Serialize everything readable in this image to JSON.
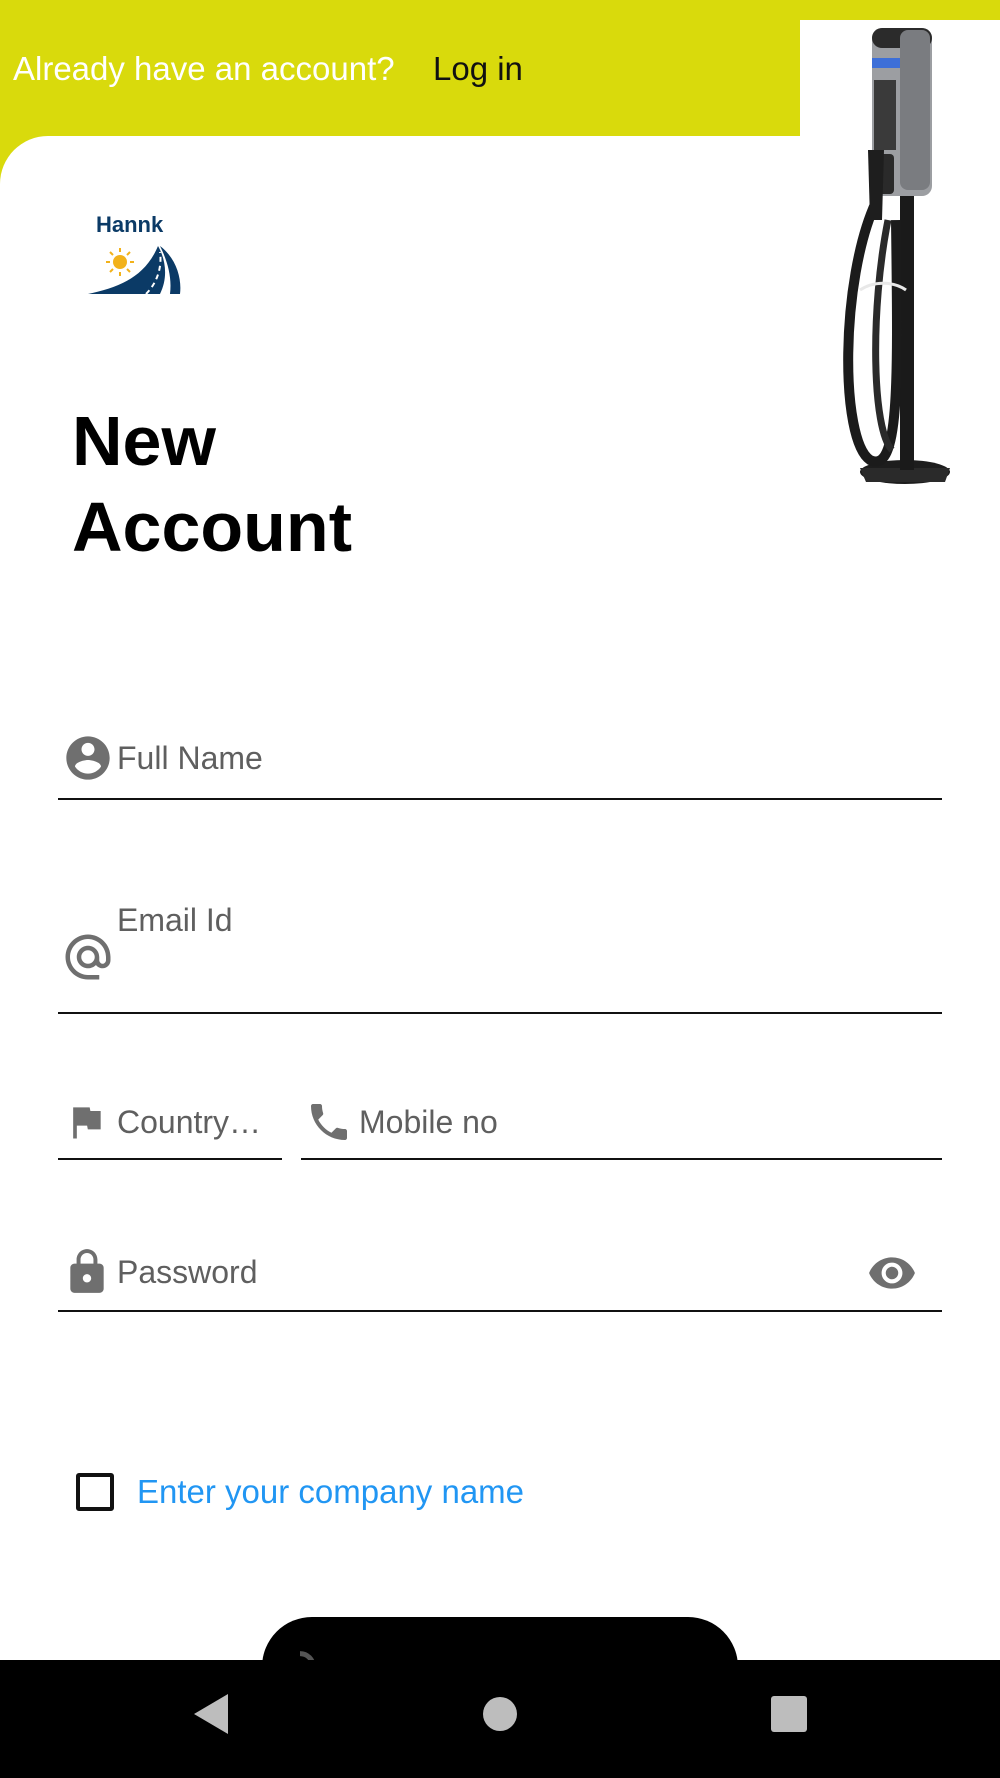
{
  "topbar": {
    "question": "Already have an account?",
    "login_label": "Log in"
  },
  "brand": {
    "logo_text": "Hannk",
    "colors": {
      "accent": "#d9da0c",
      "logo_blue": "#0b3a66",
      "sun": "#f2b21b",
      "link": "#2196f3"
    }
  },
  "page": {
    "title_line1": "New",
    "title_line2": "Account"
  },
  "form": {
    "full_name": {
      "placeholder": "Full Name",
      "icon": "account-circle-icon"
    },
    "email": {
      "placeholder": "Email Id",
      "icon": "at-sign-icon"
    },
    "country": {
      "placeholder": "Country…",
      "icon": "flag-icon"
    },
    "mobile": {
      "placeholder": "Mobile no",
      "icon": "phone-icon"
    },
    "password": {
      "placeholder": "Password",
      "icon": "lock-icon",
      "toggle_icon": "eye-icon"
    },
    "company_checkbox_label": "Enter your company name"
  },
  "navbar": {
    "icons": [
      "back-icon",
      "home-icon",
      "recents-icon"
    ]
  }
}
